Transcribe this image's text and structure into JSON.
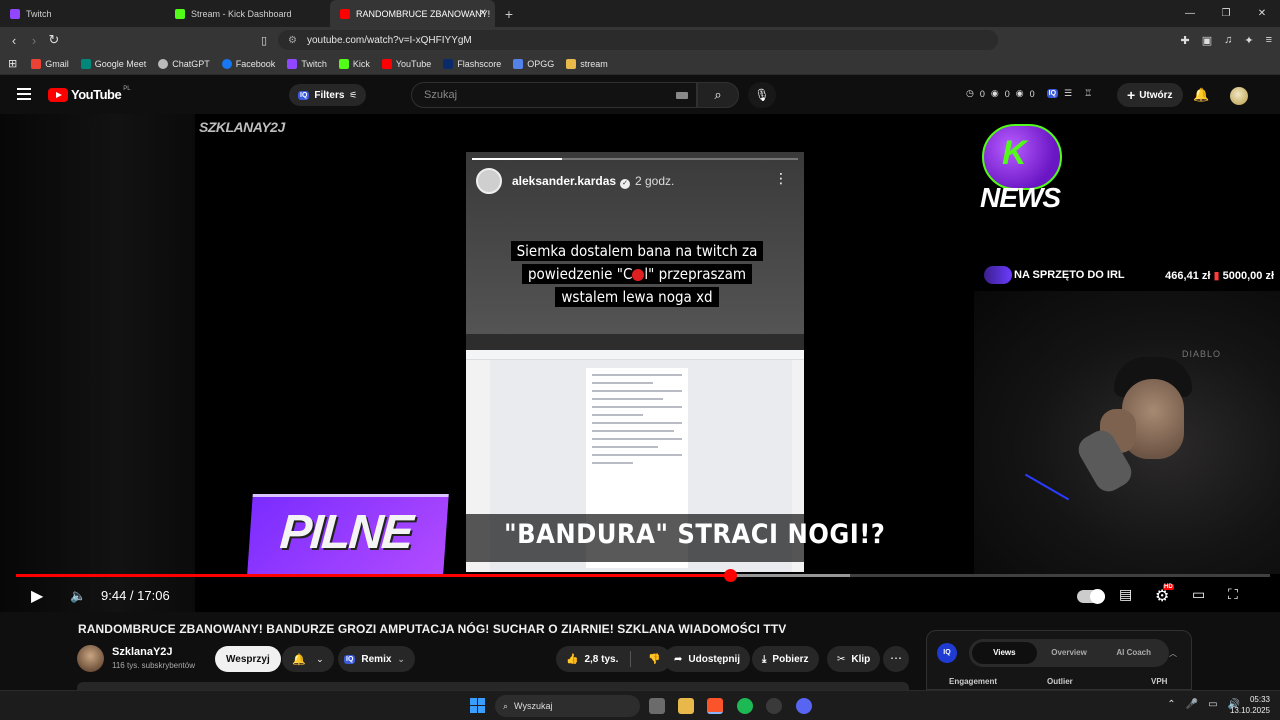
{
  "browser": {
    "tabs": [
      {
        "label": "Twitch",
        "color": "#9146ff",
        "active": false
      },
      {
        "label": "Stream - Kick Dashboard",
        "color": "#53fc18",
        "active": false
      },
      {
        "label": "RANDOMBRUCE ZBANOWANY!",
        "color": "#ff0000",
        "active": true
      }
    ],
    "url": "youtube.com/watch?v=I-xQHFIYYgM",
    "bookmarks": [
      {
        "label": "Gmail",
        "color": "#ea4335"
      },
      {
        "label": "Google Meet",
        "color": "#00897b"
      },
      {
        "label": "ChatGPT",
        "color": "#bbbbbb"
      },
      {
        "label": "Facebook",
        "color": "#1877f2"
      },
      {
        "label": "Twitch",
        "color": "#9146ff"
      },
      {
        "label": "Kick",
        "color": "#53fc18"
      },
      {
        "label": "YouTube",
        "color": "#ff0000"
      },
      {
        "label": "Flashscore",
        "color": "#0a2a6a"
      },
      {
        "label": "OPGG",
        "color": "#5383e8"
      },
      {
        "label": "stream",
        "color": "#e8b84a"
      }
    ]
  },
  "youtube": {
    "logo_text": "YouTube",
    "region": "PL",
    "filters_label": "Filters",
    "iq_badge": "IQ",
    "search_placeholder": "Szukaj",
    "stats": [
      "0",
      "0",
      "0"
    ],
    "create_label": "Utwórz"
  },
  "video": {
    "overlay": {
      "brand": "SZKLANAY2J",
      "post_user": "aleksander.kardas",
      "post_time": "2 godz.",
      "caption_1": "Siemka dostalem bana na twitch za",
      "caption_2_pre": "powiedzenie \"C",
      "caption_2_post": "l\" przepraszam",
      "caption_3": "wstalem lewa noga xd",
      "news_k": "K",
      "news_word": "NEWS",
      "goal_label": "NA SPRZĘTO DO IRL",
      "goal_current": "466,41 zł",
      "goal_target": "5000,00 zł",
      "cam_label": "DIABLO",
      "pilne": "PILNE",
      "headline": "\"BANDURA\" STRACI NOGI!?"
    },
    "current_time": "9:44",
    "duration": "17:06",
    "progress_fraction": 0.5696,
    "buffered_fraction": 0.665,
    "hd_badge": "HD"
  },
  "details": {
    "title": "RANDOMBRUCE ZBANOWANY! BANDURZE GROZI AMPUTACJA NÓG! SUCHAR O ZIARNIE! SZKLANA WIADOMOŚCI TTV",
    "channel_name": "SzklanaY2J",
    "subscribers": "116 tys. subskrybentów",
    "support_label": "Wesprzyj",
    "remix_label": "Remix",
    "likes": "2,8 tys.",
    "share_label": "Udostępnij",
    "download_label": "Pobierz",
    "clip_label": "Klip"
  },
  "iq_panel": {
    "logo": "IQ",
    "tabs": [
      "Views",
      "Overview",
      "AI Coach"
    ],
    "active_tab": 0,
    "columns": [
      "Engagement",
      "Outlier",
      "VPH"
    ]
  },
  "taskbar": {
    "search_placeholder": "Wyszukaj",
    "time": "05:33",
    "date": "13.10.2025"
  },
  "colors": {
    "yt_red": "#ff0000",
    "kick_green": "#53fc18",
    "purple": "#7a2cff"
  }
}
